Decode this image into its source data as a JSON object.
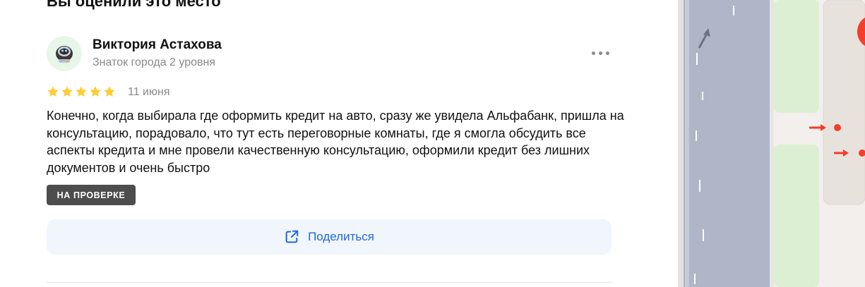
{
  "section": {
    "title": "Вы оценили это место"
  },
  "review": {
    "author_name": "Виктория Астахова",
    "author_level": "Знаток города 2 уровня",
    "rating": 5,
    "date": "11 июня",
    "text": "Конечно, когда выбирала где оформить кредит на авто, сразу же увидела Альфабанк, пришла на консультацию, порадовало, что тут есть переговорные комнаты, где я смогла обсудить все аспекты кредита и мне провели качественную консультацию, оформили кредит без лишних документов и очень быстро",
    "status_badge": "НА ПРОВЕРКЕ"
  },
  "share": {
    "label": "Поделиться"
  },
  "icons": {
    "more": "more-dots-icon",
    "share": "share-external-icon",
    "star": "star-icon",
    "avatar": "robot-avatar"
  },
  "colors": {
    "star": "#fc3",
    "share_text": "#1f67e0",
    "share_bg": "#f1f5fc",
    "badge_bg": "#4d4d4d",
    "map_road": "#aeb6c8",
    "map_green": "#dcefd2",
    "map_marker": "#f43d2c"
  }
}
